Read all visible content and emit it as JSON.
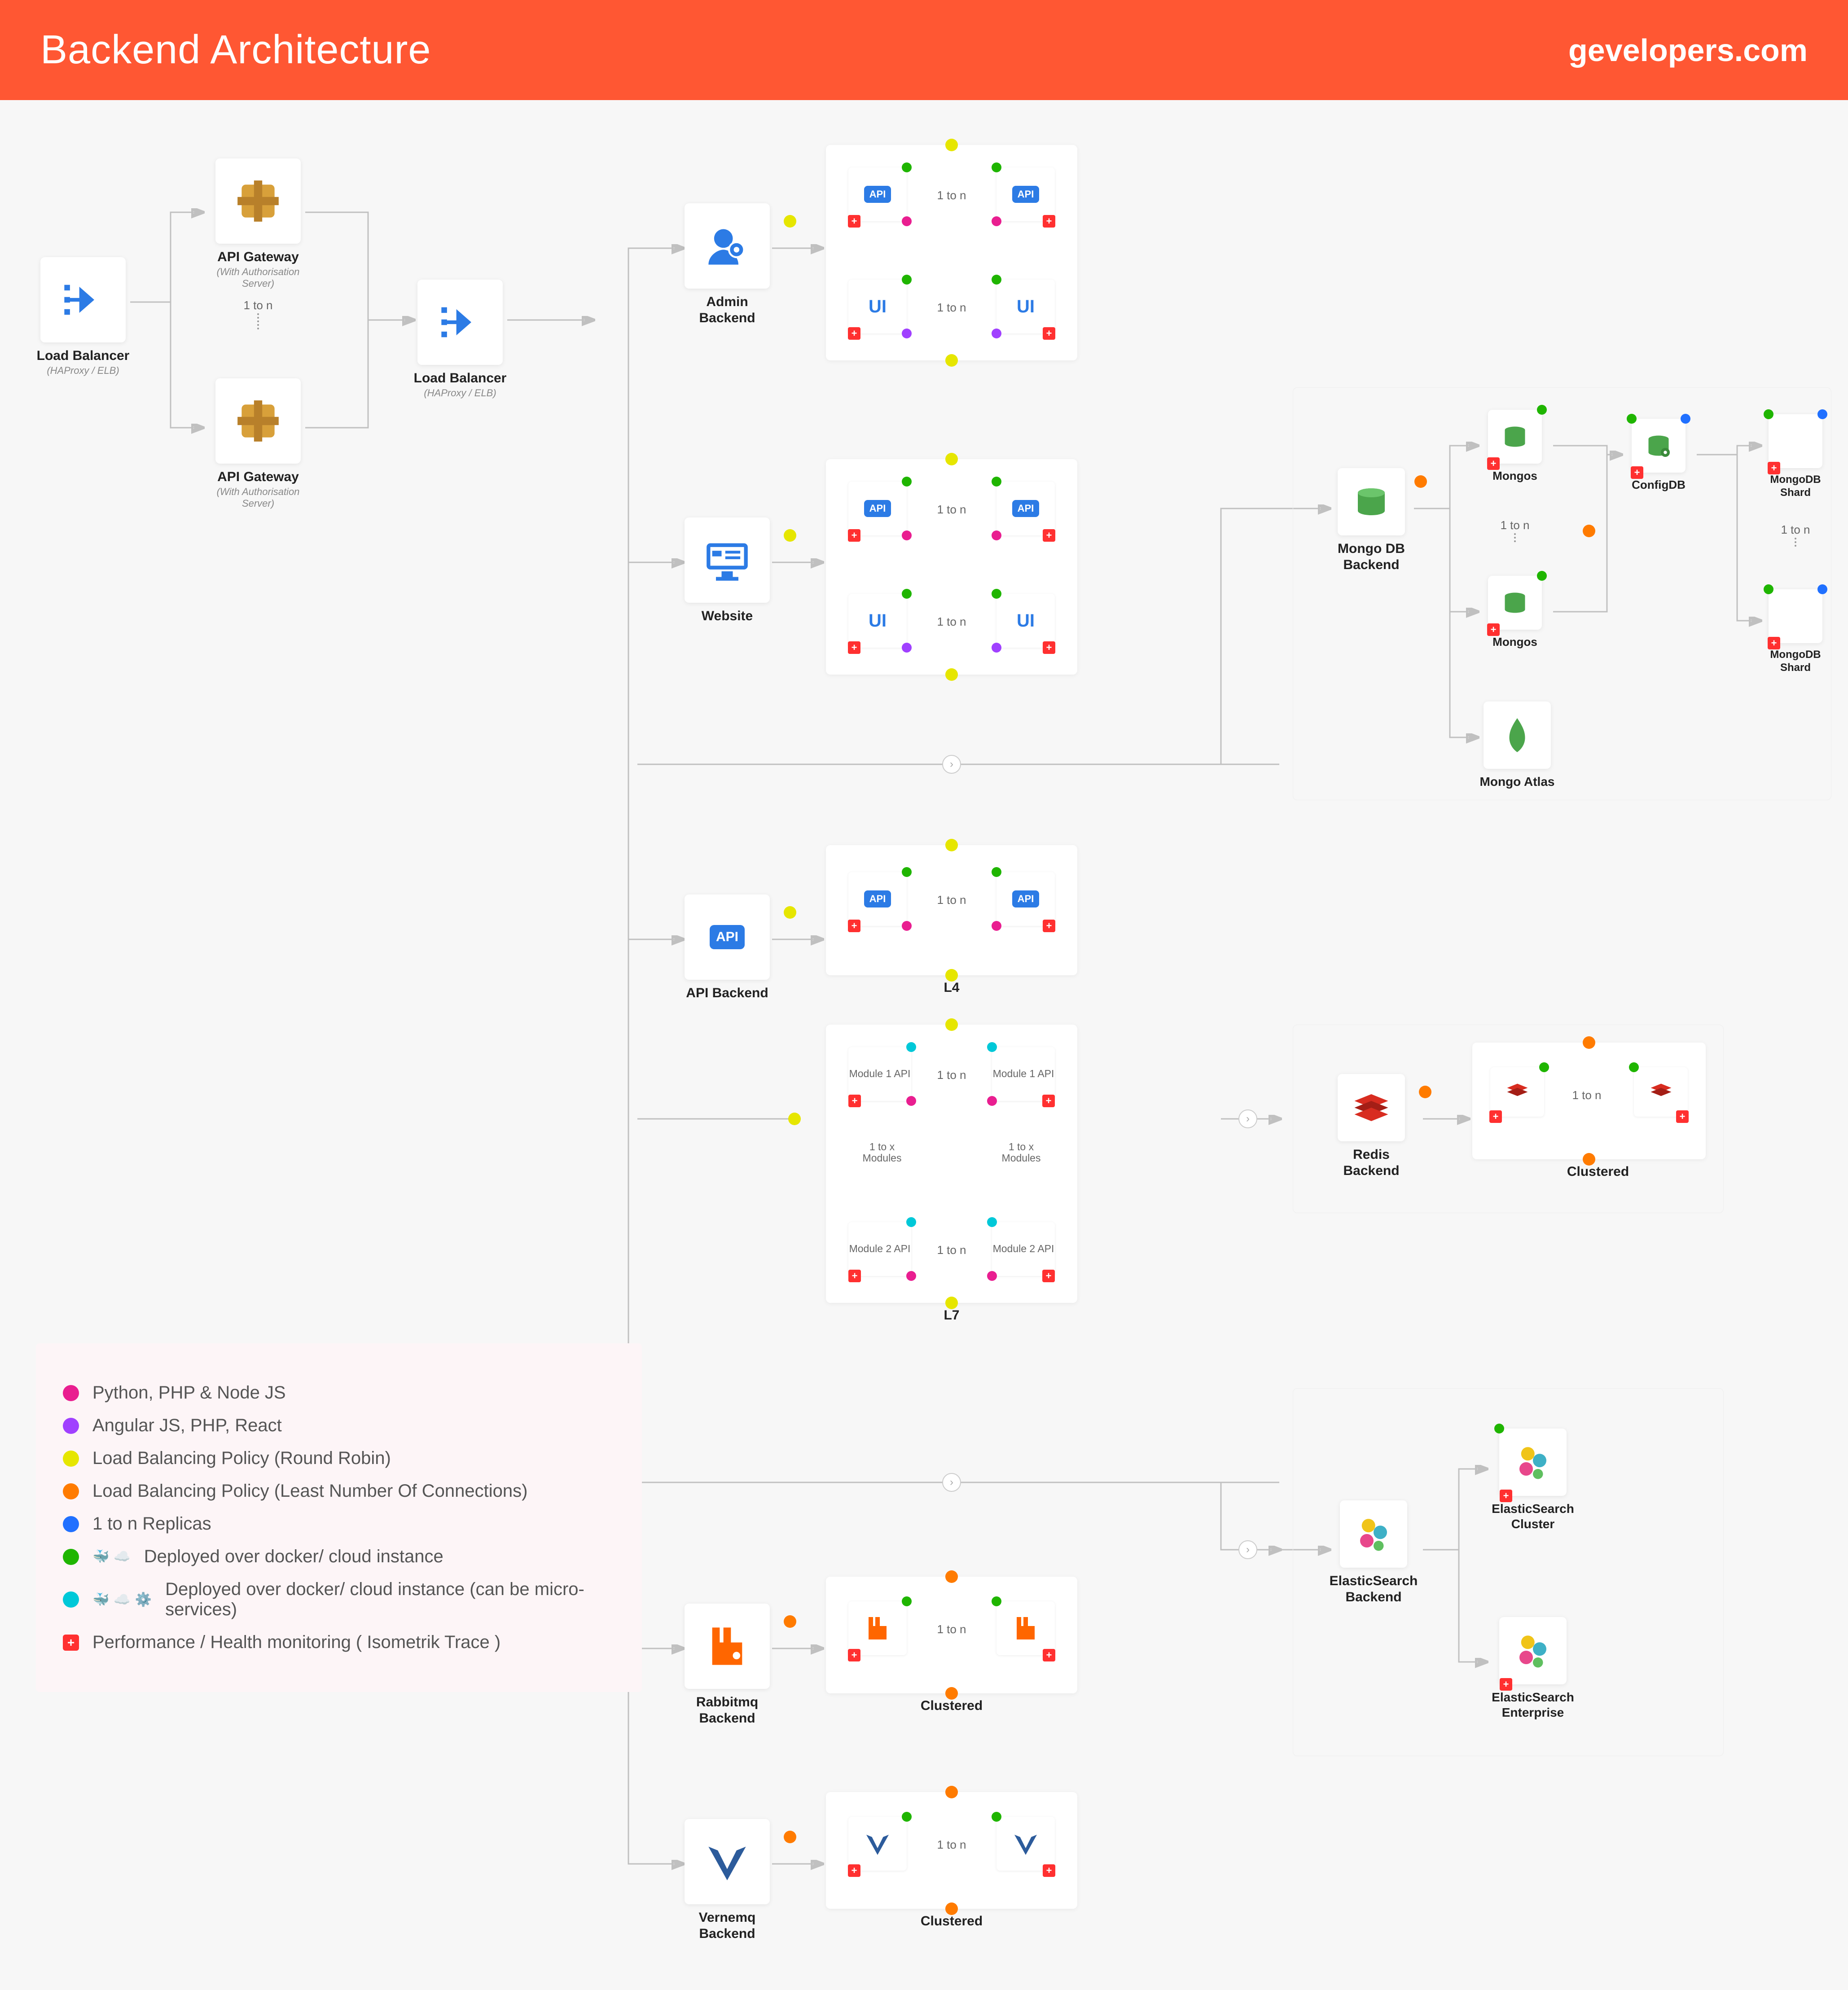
{
  "header": {
    "title": "Backend Architecture",
    "site": "gevelopers.com"
  },
  "nodes": {
    "lb1": {
      "label": "Load Balancer",
      "sub": "(HAProxy / ELB)"
    },
    "apigw1": {
      "label": "API Gateway",
      "sub": "(With Authorisation Server)"
    },
    "apigw2": {
      "label": "API Gateway",
      "sub": "(With Authorisation Server)"
    },
    "lb2": {
      "label": "Load Balancer",
      "sub": "(HAProxy / ELB)"
    },
    "admin": {
      "label": "Admin Backend"
    },
    "website": {
      "label": "Website"
    },
    "apibe": {
      "label": "API Backend"
    },
    "rabbit": {
      "label": "Rabbitmq Backend"
    },
    "vernemq": {
      "label": "Vernemq Backend"
    },
    "mongo": {
      "label": "Mongo DB Backend"
    },
    "mongos1": {
      "label": "Mongos"
    },
    "mongos2": {
      "label": "Mongos"
    },
    "configdb": {
      "label": "ConfigDB"
    },
    "shard1": {
      "label": "MongoDB Shard"
    },
    "shard2": {
      "label": "MongoDB Shard"
    },
    "atlas": {
      "label": "Mongo Atlas"
    },
    "redis": {
      "label": "Redis Backend"
    },
    "es": {
      "label": "ElasticSearch Backend"
    },
    "escluster": {
      "label": "ElasticSearch Cluster"
    },
    "esent": {
      "label": "ElasticSearch Enterprise"
    }
  },
  "groups": {
    "admin_cluster": {
      "api": "API",
      "ui": "UI",
      "range": "1 to n"
    },
    "website_cluster": {
      "api": "API",
      "ui": "UI",
      "range": "1 to n"
    },
    "api_l4": {
      "api": "API",
      "range": "1 to n",
      "label": "L4"
    },
    "api_l7": {
      "m1": "Module 1 API",
      "m2": "Module 2 API",
      "range": "1 to n",
      "modrange": "1 to x Modules",
      "label": "L7"
    },
    "rabbit_cluster": {
      "range": "1 to n",
      "label": "Clustered"
    },
    "vernemq_cluster": {
      "range": "1 to n",
      "label": "Clustered"
    },
    "mongo_range": "1 to n",
    "shard_range": "1 to n",
    "redis_cluster": {
      "range": "1 to n",
      "label": "Clustered"
    }
  },
  "legend": [
    {
      "color": "c-pink",
      "text": "Python, PHP & Node JS"
    },
    {
      "color": "c-purple",
      "text": "Angular JS, PHP, React"
    },
    {
      "color": "c-yellow",
      "text": "Load Balancing Policy (Round Robin)"
    },
    {
      "color": "c-orange",
      "text": "Load Balancing Policy (Least Number Of Connections)"
    },
    {
      "color": "c-blue",
      "text": "1 to n Replicas"
    },
    {
      "color": "c-green",
      "text": "Deployed over docker/ cloud instance",
      "icons": true
    },
    {
      "color": "c-cyan",
      "text": "Deployed over docker/ cloud instance (can be micro-services)",
      "icons": true
    },
    {
      "plus": true,
      "text": "Performance / Health monitoring ( Isometrik Trace )"
    }
  ]
}
